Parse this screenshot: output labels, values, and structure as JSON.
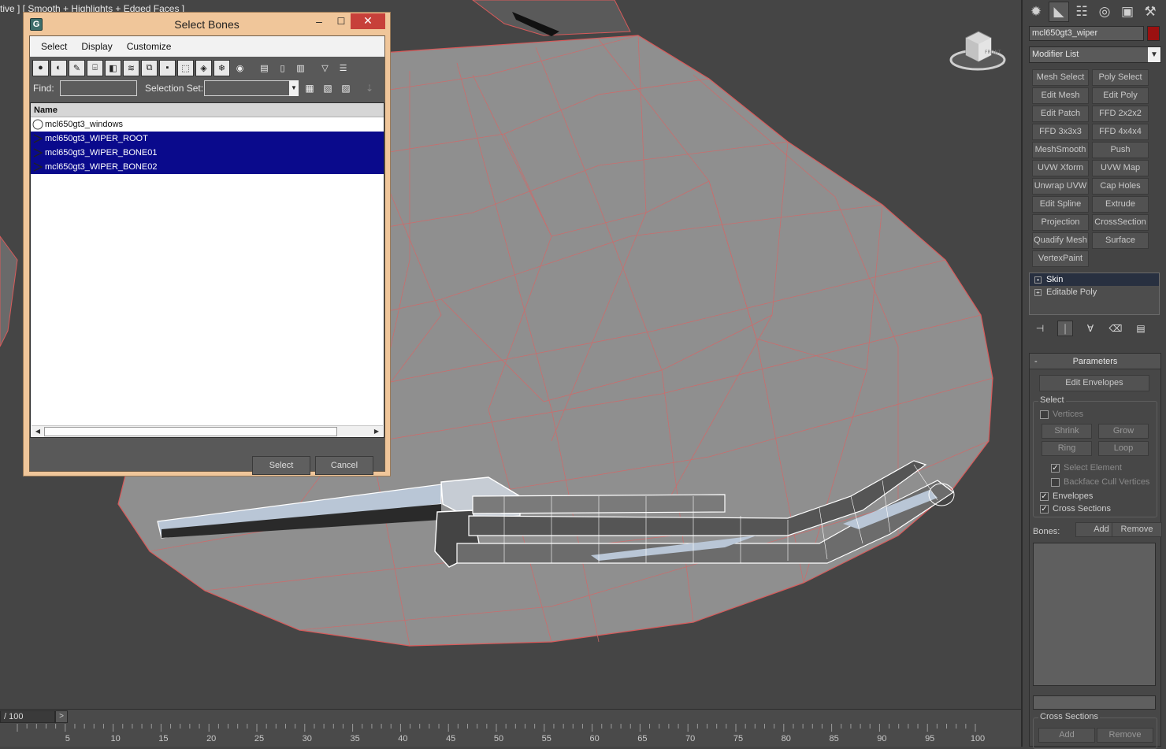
{
  "viewport": {
    "label": "tive ] [ Smooth + Highlights + Edged Faces ]",
    "viewcube_face": "FRONT"
  },
  "timeline": {
    "slider_value": "/ 100",
    "next_symbol": ">",
    "ticks": [
      "5",
      "10",
      "15",
      "20",
      "25",
      "30",
      "35",
      "40",
      "45",
      "50",
      "55",
      "60",
      "65",
      "70",
      "75",
      "80",
      "85",
      "90",
      "95",
      "100"
    ]
  },
  "dialog": {
    "title": "Select Bones",
    "controls": {
      "minimize": "–",
      "maximize": "☐",
      "close": "✕"
    },
    "menu": [
      "Select",
      "Display",
      "Customize"
    ],
    "find_label": "Find:",
    "find_value": "",
    "selection_set_label": "Selection Set:",
    "selection_set_value": "",
    "column_header": "Name",
    "rows": [
      {
        "name": "mcl650gt3_windows",
        "selected": false,
        "kind": "mesh"
      },
      {
        "name": "mcl650gt3_WIPER_ROOT",
        "selected": true,
        "kind": "bone"
      },
      {
        "name": "mcl650gt3_WIPER_BONE01",
        "selected": true,
        "kind": "bone"
      },
      {
        "name": "mcl650gt3_WIPER_BONE02",
        "selected": true,
        "kind": "bone"
      }
    ],
    "select_button": "Select",
    "cancel_button": "Cancel"
  },
  "command_panel": {
    "object_name": "mcl650gt3_wiper",
    "object_color": "#9b1010",
    "modifier_list_label": "Modifier List",
    "modifier_buttons": [
      "Mesh Select",
      "Poly Select",
      "Edit Mesh",
      "Edit Poly",
      "Edit Patch",
      "FFD 2x2x2",
      "FFD 3x3x3",
      "FFD 4x4x4",
      "MeshSmooth",
      "Push",
      "UVW Xform",
      "UVW Map",
      "Unwrap UVW",
      "Cap Holes",
      "Edit Spline",
      "Extrude",
      "Projection",
      "CrossSection",
      "Quadify Mesh",
      "Surface",
      "VertexPaint"
    ],
    "stack": [
      {
        "label": "Skin",
        "selected": true
      },
      {
        "label": "Editable Poly",
        "selected": false
      }
    ],
    "rollout_title": "Parameters",
    "edit_envelopes": "Edit Envelopes",
    "select_group": "Select",
    "vertices_label": "Vertices",
    "shrink": "Shrink",
    "grow": "Grow",
    "ring": "Ring",
    "loop": "Loop",
    "select_element": "Select Element",
    "backface_cull": "Backface Cull Vertices",
    "envelopes": "Envelopes",
    "cross_sections": "Cross Sections",
    "bones_label": "Bones:",
    "bones_add": "Add",
    "bones_remove": "Remove",
    "cross_sections_group": "Cross Sections",
    "cs_add": "Add",
    "cs_remove": "Remove"
  },
  "colors": {
    "viewport_bg": "#454545",
    "wireframe": "#d85a5a",
    "selection_blue": "#0a0a8c",
    "close_red": "#c7403a",
    "dialog_frame": "#f0c69a"
  }
}
